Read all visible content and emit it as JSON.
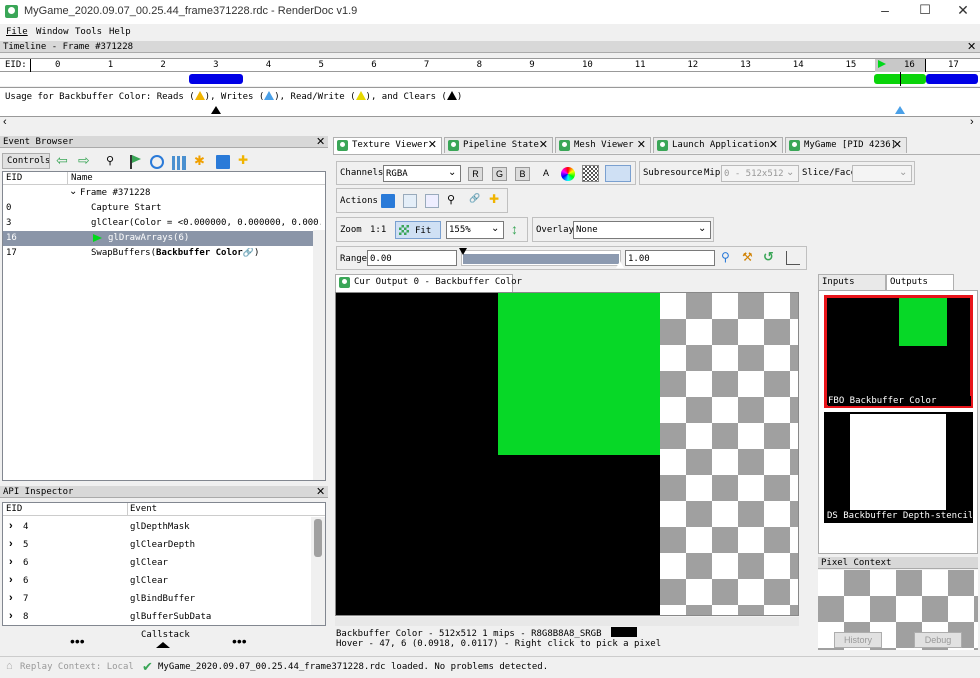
{
  "window": {
    "title": "MyGame_2020.09.07_00.25.44_frame371228.rdc - RenderDoc v1.9"
  },
  "menu": [
    "File",
    "Window",
    "Tools",
    "Help"
  ],
  "timeline": {
    "title": "Timeline - Frame #371228",
    "eid_label": "EID:",
    "ticks": [
      "0",
      "1",
      "2",
      "3",
      "4",
      "5",
      "6",
      "7",
      "8",
      "9",
      "10",
      "11",
      "12",
      "13",
      "14",
      "15",
      "16",
      "17"
    ],
    "usage_text": "Usage for Backbuffer Color: Reads (",
    "usage_writes": "), Writes (",
    "usage_rw": "), Read/Write (",
    "usage_clears": "), and Clears (",
    "usage_end": ")"
  },
  "event_browser": {
    "title": "Event Browser",
    "controls_label": "Controls",
    "col_eid": "EID",
    "col_name": "Name",
    "rows": [
      {
        "eid": "",
        "name": "Frame #371228"
      },
      {
        "eid": "0",
        "name": "Capture Start"
      },
      {
        "eid": "3",
        "name": "glClear(Color = <0.000000, 0.000000, 0.000..."
      },
      {
        "eid": "16",
        "name": "glDrawArrays(6)"
      },
      {
        "eid": "17",
        "name": "SwapBuffers(",
        "bold": "Backbuffer Color",
        "tail": ")"
      }
    ]
  },
  "api_inspector": {
    "title": "API Inspector",
    "col_eid": "EID",
    "col_event": "Event",
    "rows": [
      {
        "eid": "4",
        "event": "glDepthMask"
      },
      {
        "eid": "5",
        "event": "glClearDepth"
      },
      {
        "eid": "6",
        "event": "glClear"
      },
      {
        "eid": "6",
        "event": "glClear"
      },
      {
        "eid": "7",
        "event": "glBindBuffer"
      },
      {
        "eid": "8",
        "event": "glBufferSubData"
      }
    ],
    "callstack_label": "Callstack",
    "dots": "•••"
  },
  "tabs": [
    "Texture Viewer",
    "Pipeline State",
    "Mesh Viewer",
    "Launch Application",
    "MyGame [PID 4236]"
  ],
  "texture_viewer": {
    "channels_label": "Channels",
    "channels_value": "RGBA",
    "ch_r": "R",
    "ch_g": "G",
    "ch_b": "B",
    "ch_a": "A",
    "subresource_label": "Subresource",
    "mip_label": "Mip",
    "mip_value": "0 - 512x512",
    "slice_label": "Slice/Face",
    "actions_label": "Actions",
    "zoom_label": "Zoom",
    "zoom_1to1": "1:1",
    "fit_label": "Fit",
    "zoom_value": "155%",
    "overlay_label": "Overlay",
    "overlay_value": "None",
    "range_label": "Range",
    "range_min": "0.00",
    "range_max": "1.00",
    "output_tab": "Cur Output 0 - Backbuffer Color",
    "status_line1": "Backbuffer Color  - 512x512 1 mips - R8G8B8A8_SRGB",
    "status_line2": "Hover -     47,     6 (0.0918, 0.0117)  - Right click to pick a pixel"
  },
  "thumbs": {
    "tab_inputs": "Inputs",
    "tab_outputs": "Outputs",
    "thumb1_label": "FBO     Backbuffer Color",
    "thumb2_label": "DS  Backbuffer Depth-stencil"
  },
  "pixel_context": {
    "title": "Pixel Context",
    "history": "History",
    "debug": "Debug"
  },
  "statusbar": {
    "replay": "Replay Context: Local",
    "message": "MyGame_2020.09.07_00.25.44_frame371228.rdc loaded.  No problems detected."
  },
  "colors": {
    "accent_green": "#3aa657",
    "triangle_green": "#00d91a",
    "selected_row": "#8a95a8",
    "highlight_red": "#e8141a"
  }
}
